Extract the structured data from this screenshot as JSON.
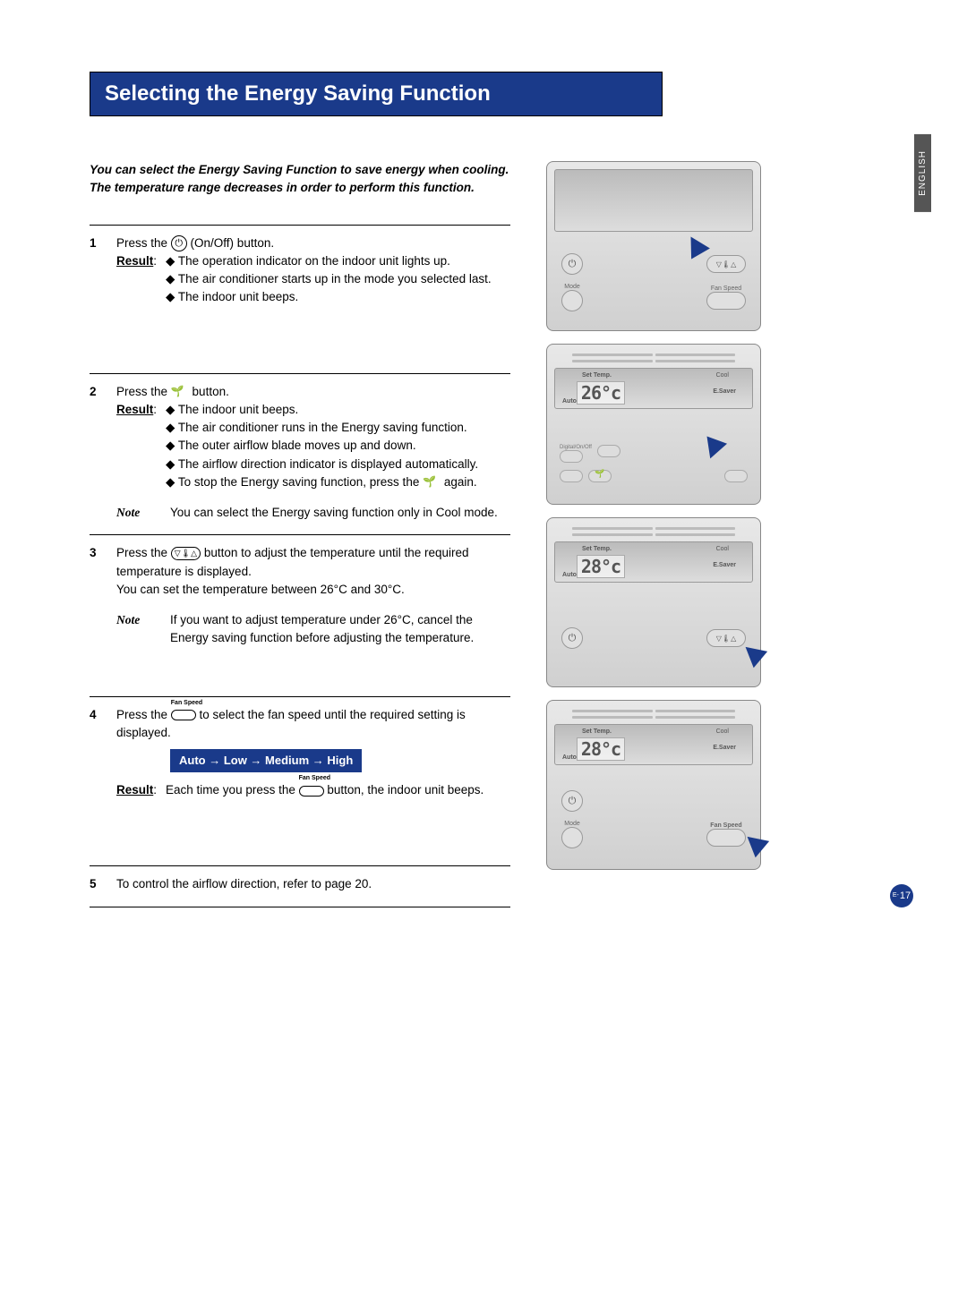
{
  "title": "Selecting the Energy Saving Function",
  "language_tab": "ENGLISH",
  "intro_line1": "You can select the Energy Saving Function to save energy when cooling.",
  "intro_line2": "The temperature range decreases in order to perform this function.",
  "steps": {
    "s1": {
      "num": "1",
      "text_a": "Press the ",
      "text_b": " (On/Off) button.",
      "result_label": "Result",
      "bullets": [
        "The operation indicator on the indoor unit lights up.",
        "The air conditioner starts up in the mode you selected last.",
        "The indoor unit beeps."
      ]
    },
    "s2": {
      "num": "2",
      "text_a": "Press the ",
      "text_b": " button.",
      "result_label": "Result",
      "bullets": [
        "The indoor unit beeps.",
        "The air conditioner runs in the Energy saving function.",
        "The outer airflow blade moves up and down.",
        "The airflow direction indicator is displayed automatically."
      ],
      "bullet_last_a": "To stop the Energy saving function, press the ",
      "bullet_last_b": " again.",
      "note_label": "Note",
      "note_text": "You can select the Energy saving function only in Cool mode."
    },
    "s3": {
      "num": "3",
      "text_a": "Press the ",
      "text_b": " button to adjust the temperature until the required temperature is displayed.",
      "text_c": "You can set the temperature between 26°C and 30°C.",
      "note_label": "Note",
      "note_text": "If you want to adjust temperature under 26°C, cancel the Energy saving function before adjusting the temperature."
    },
    "s4": {
      "num": "4",
      "text_a": "Press the ",
      "text_b": " to select the fan speed until the required setting is displayed.",
      "fanspeed_label": "Fan Speed",
      "sequence": "Auto → Low → Medium → High",
      "result_label": "Result",
      "result_a": "Each time you press the ",
      "result_b": " button, the indoor unit beeps."
    },
    "s5": {
      "num": "5",
      "text": "To control the airflow direction, refer to page 20."
    }
  },
  "remote": {
    "mode": "Mode",
    "fanspeed": "Fan Speed",
    "settemp": "Set Temp.",
    "cool": "Cool",
    "esaver": "E.Saver",
    "auto": "Auto",
    "temp26": "26°c",
    "temp28": "28°c",
    "digital": "Digital/On/Off"
  },
  "page_number": {
    "prefix": "E-",
    "num": "17"
  }
}
